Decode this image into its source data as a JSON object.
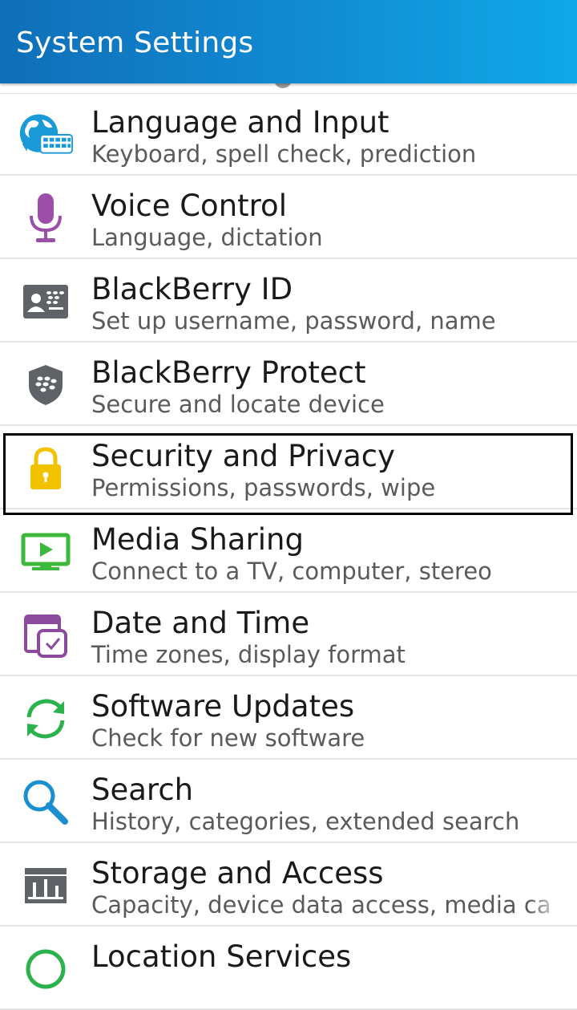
{
  "header": {
    "title": "System Settings"
  },
  "items": [
    {
      "title": "Language and Input",
      "subtitle": "Keyboard, spell check, prediction",
      "icon": "globe-keyboard-icon"
    },
    {
      "title": "Voice Control",
      "subtitle": "Language, dictation",
      "icon": "microphone-icon"
    },
    {
      "title": "BlackBerry ID",
      "subtitle": "Set up username, password, name",
      "icon": "id-card-icon"
    },
    {
      "title": "BlackBerry Protect",
      "subtitle": "Secure and locate device",
      "icon": "shield-icon"
    },
    {
      "title": "Security and Privacy",
      "subtitle": "Permissions, passwords, wipe",
      "icon": "lock-icon",
      "highlighted": true
    },
    {
      "title": "Media Sharing",
      "subtitle": "Connect to a TV, computer, stereo",
      "icon": "tv-play-icon"
    },
    {
      "title": "Date and Time",
      "subtitle": "Time zones, display format",
      "icon": "calendar-clock-icon"
    },
    {
      "title": "Software Updates",
      "subtitle": "Check for new software",
      "icon": "sync-icon"
    },
    {
      "title": "Search",
      "subtitle": "History, categories, extended search",
      "icon": "search-icon"
    },
    {
      "title": "Storage and Access",
      "subtitle": "Capacity, device data access, media ca",
      "icon": "storage-icon"
    },
    {
      "title": "Location Services",
      "subtitle": "",
      "icon": "location-icon"
    }
  ],
  "colors": {
    "header_start": "#0f6fb8",
    "header_end": "#0fa8e8",
    "globe": "#1a9ad6",
    "mic": "#9b4fa8",
    "bb_gray": "#5f6368",
    "lock": "#f2c200",
    "media": "#3cb83c",
    "calendar": "#8c4a9c",
    "updates": "#2bb24c",
    "search": "#1a8fd0"
  }
}
